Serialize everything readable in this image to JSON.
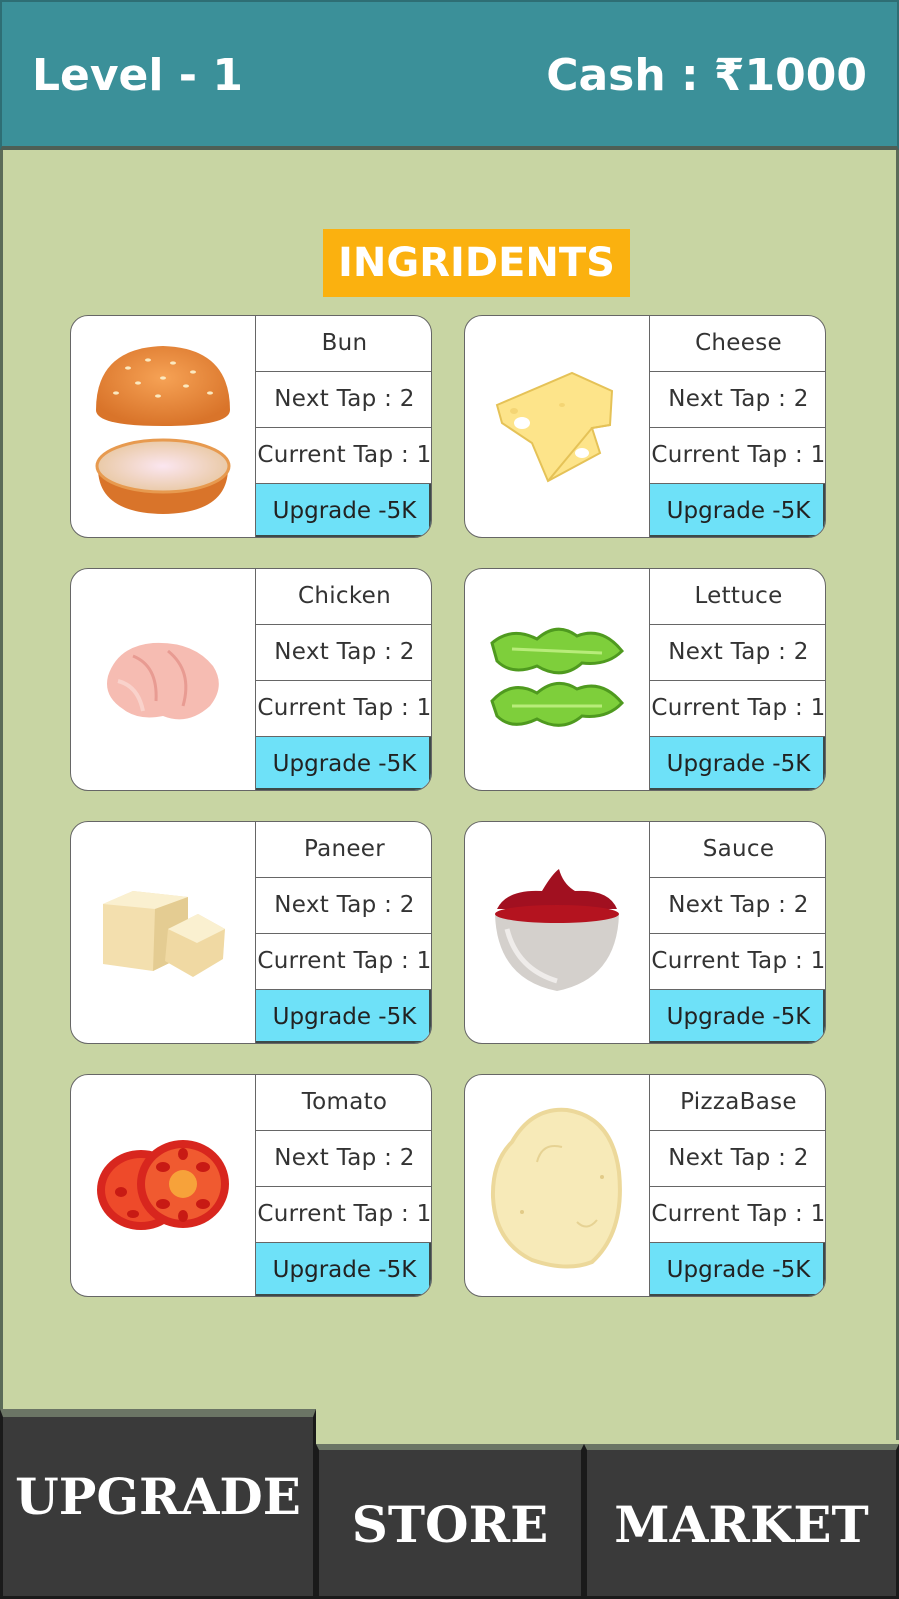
{
  "header": {
    "level_label": "Level - 1",
    "cash_label": "Cash : ₹1000"
  },
  "section_title": "INGRIDENTS",
  "ingredients": [
    {
      "name": "Bun",
      "next_tap": "Next Tap : 2",
      "current_tap": "Current Tap : 1",
      "upgrade": "Upgrade -5K",
      "icon": "burger-bun-icon"
    },
    {
      "name": "Cheese",
      "next_tap": "Next Tap : 2",
      "current_tap": "Current Tap : 1",
      "upgrade": "Upgrade -5K",
      "icon": "cheese-icon"
    },
    {
      "name": "Chicken",
      "next_tap": "Next Tap : 2",
      "current_tap": "Current Tap : 1",
      "upgrade": "Upgrade -5K",
      "icon": "chicken-icon"
    },
    {
      "name": "Lettuce",
      "next_tap": "Next Tap : 2",
      "current_tap": "Current Tap : 1",
      "upgrade": "Upgrade -5K",
      "icon": "lettuce-icon"
    },
    {
      "name": "Paneer",
      "next_tap": "Next Tap : 2",
      "current_tap": "Current Tap : 1",
      "upgrade": "Upgrade -5K",
      "icon": "paneer-icon"
    },
    {
      "name": "Sauce",
      "next_tap": "Next Tap : 2",
      "current_tap": "Current Tap : 1",
      "upgrade": "Upgrade -5K",
      "icon": "sauce-bowl-icon"
    },
    {
      "name": "Tomato",
      "next_tap": "Next Tap : 2",
      "current_tap": "Current Tap : 1",
      "upgrade": "Upgrade -5K",
      "icon": "tomato-slice-icon"
    },
    {
      "name": "PizzaBase",
      "next_tap": "Next Tap : 2",
      "current_tap": "Current Tap : 1",
      "upgrade": "Upgrade -5K",
      "icon": "pizza-dough-icon"
    }
  ],
  "footer": {
    "upgrade_tab": "UPGRADE",
    "store_tab": "STORE",
    "market_tab": "MARKET"
  },
  "colors": {
    "header_bg": "#3b9099",
    "background": "#c8d5a3",
    "title_bg": "#fbb10f",
    "upgrade_button": "#6ee1f8",
    "footer_bg": "#3a3a3a"
  }
}
